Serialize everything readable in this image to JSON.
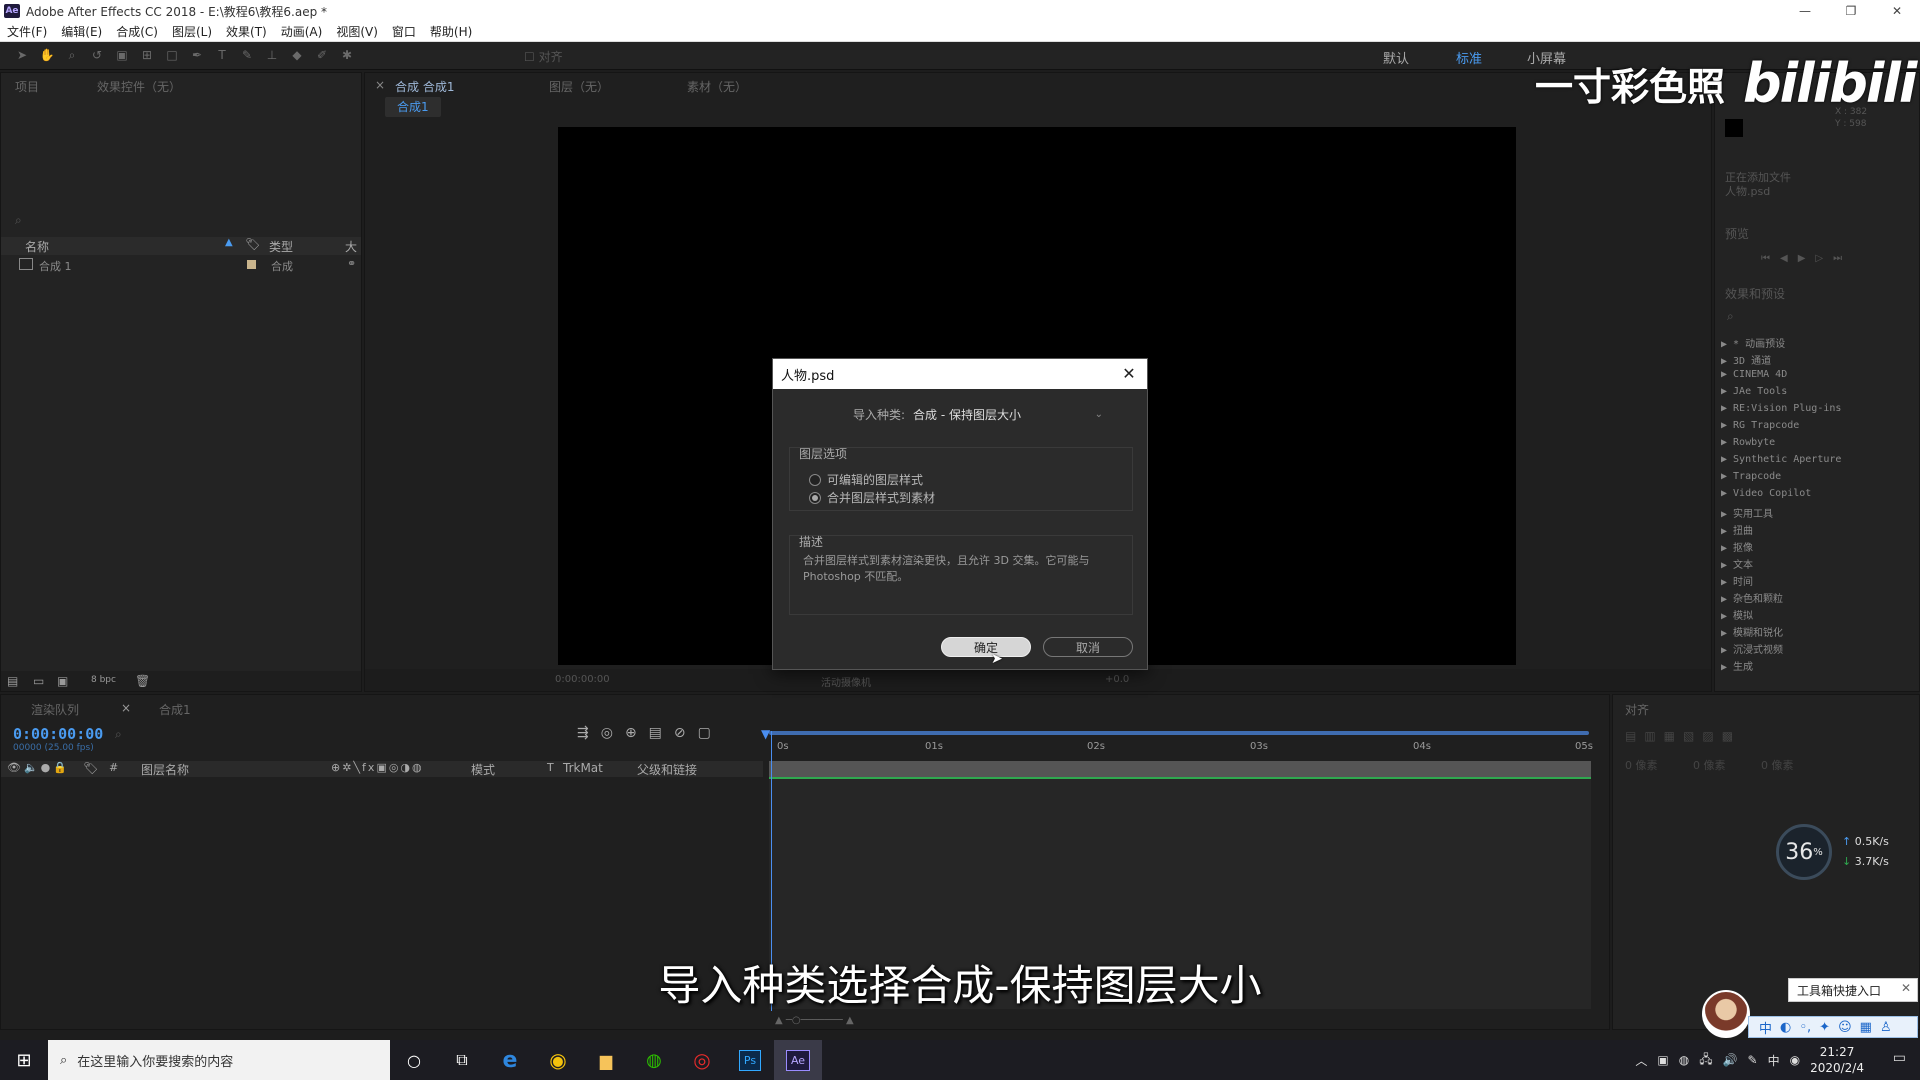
{
  "window": {
    "title": "Adobe After Effects CC 2018 - E:\\教程6\\教程6.aep *",
    "app_icon": "Ae",
    "controls": [
      "—",
      "❐",
      "✕"
    ]
  },
  "menu": [
    "文件(F)",
    "编辑(E)",
    "合成(C)",
    "图层(L)",
    "效果(T)",
    "动画(A)",
    "视图(V)",
    "窗口",
    "帮助(H)"
  ],
  "toolbar": {
    "align_label": "对齐",
    "workspaces": [
      {
        "label": "默认",
        "active": false
      },
      {
        "label": "标准",
        "active": true
      },
      {
        "label": "小屏幕",
        "active": false
      }
    ]
  },
  "project_panel": {
    "tab_project": "项目",
    "tab_effects_controls": "效果控件（无）",
    "columns": {
      "name": "名称",
      "type": "类型",
      "size": "大"
    },
    "items": [
      {
        "name": "合成 1",
        "type": "合成"
      }
    ],
    "bpc": "8 bpc"
  },
  "viewer": {
    "tab_comp": "合成 合成1",
    "tab_layer": "图层（无）",
    "tab_footage": "素材（无）",
    "comp_tab": "合成1",
    "timecode": "0:00:00:00",
    "view_label": "活动摄像机",
    "offset": "+0.0"
  },
  "right_panels": {
    "info_values": {
      "x": "X : 382",
      "y": "Y : 598"
    },
    "status_line1": "正在添加文件",
    "status_line2": "人物.psd",
    "preview_title": "预览",
    "effects_title": "效果和预设",
    "effects": [
      "* 动画预设",
      "3D 通道",
      "CINEMA 4D",
      "JAe Tools",
      "RE:Vision Plug-ins",
      "RG Trapcode",
      "Rowbyte",
      "Synthetic Aperture",
      "Trapcode",
      "Video Copilot",
      "实用工具",
      "扭曲",
      "抠像",
      "文本",
      "时间",
      "杂色和颗粒",
      "模拟",
      "模糊和锐化",
      "沉浸式视频",
      "生成"
    ]
  },
  "timeline": {
    "tab_render_queue": "渲染队列",
    "tab_comp": "合成1",
    "timecode": "0:00:00:00",
    "timecode_sub": "00000 (25.00 fps)",
    "columns": {
      "layer_name": "图层名称",
      "mode": "模式",
      "trkmat": "TrkMat",
      "parent": "父级和链接"
    },
    "ruler": [
      "0s",
      "01s",
      "02s",
      "03s",
      "04s",
      "05s"
    ],
    "align_title": "对齐",
    "align_labels": [
      "0 像素",
      "0 像素",
      "0 像素"
    ]
  },
  "dialog": {
    "title": "人物.psd",
    "import_kind_label": "导入种类:",
    "import_kind_value": "合成 - 保持图层大小",
    "layer_options_label": "图层选项",
    "options": [
      {
        "label": "可编辑的图层样式",
        "selected": false
      },
      {
        "label": "合并图层样式到素材",
        "selected": true
      }
    ],
    "description_label": "描述",
    "description": "合并图层样式到素材渲染更快，且允许 3D 交集。它可能与 Photoshop 不匹配。",
    "ok_label": "确定",
    "cancel_label": "取消"
  },
  "subtitle": "导入种类选择合成-保持图层大小",
  "watermark": {
    "text": "一寸彩色照",
    "logo": "bilibili"
  },
  "network": {
    "percent": "36",
    "percent_unit": "%",
    "up": "0.5K/s",
    "down": "3.7K/s"
  },
  "toolbox_popup": "工具箱快捷入口",
  "ime_bar": [
    "中",
    "◐",
    "◦,",
    "✦",
    "☺",
    "▦",
    "♙"
  ],
  "taskbar": {
    "search_placeholder": "在这里输入你要搜索的内容",
    "apps": [
      "cortana",
      "task-view",
      "edge",
      "chrome",
      "explorer",
      "wechat",
      "netease-music",
      "photoshop",
      "after-effects"
    ],
    "ps_label": "Ps",
    "ae_label": "Ae",
    "time": "21:27",
    "date": "2020/2/4",
    "ime_label": "中"
  }
}
